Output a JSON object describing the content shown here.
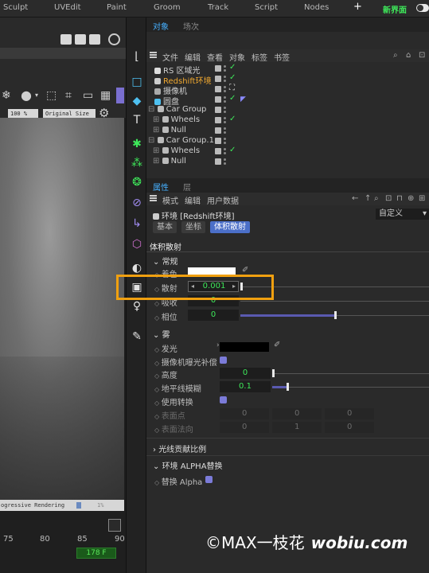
{
  "topbar": {
    "menus": [
      "Sculpt",
      "UVEdit",
      "Paint",
      "Groom",
      "Track",
      "Script",
      "Nodes"
    ],
    "plus": "+",
    "new_layout": "新界面"
  },
  "viewport": {
    "select_zoom": "100 %",
    "select_size": "Original Size",
    "progress_text": "ogressive Rendering",
    "progress_pct": "1%",
    "ticks": [
      "75",
      "80",
      "85",
      "90"
    ],
    "current_frame": "178 F"
  },
  "objects_panel": {
    "tab_objects": "对象",
    "tab_scene": "场次",
    "menu": [
      "文件",
      "编辑",
      "查看",
      "对象",
      "标签",
      "书签"
    ],
    "rows": [
      {
        "name": "RS 区域光",
        "indent": 0,
        "highlight": false
      },
      {
        "name": "Redshift环境",
        "indent": 0,
        "highlight": true
      },
      {
        "name": "摄像机",
        "indent": 0,
        "highlight": false
      },
      {
        "name": "圆盘",
        "indent": 0,
        "highlight": false
      },
      {
        "name": "Car Group",
        "indent": 0,
        "highlight": false
      },
      {
        "name": "Wheels",
        "indent": 1,
        "highlight": false
      },
      {
        "name": "Null",
        "indent": 1,
        "highlight": false
      },
      {
        "name": "Car Group.1",
        "indent": 0,
        "highlight": false
      },
      {
        "name": "Wheels",
        "indent": 1,
        "highlight": false
      },
      {
        "name": "Null",
        "indent": 1,
        "highlight": false
      }
    ]
  },
  "attributes_panel": {
    "tab_attributes": "属性",
    "tab_layers": "层",
    "menu": [
      "模式",
      "编辑",
      "用户数据"
    ],
    "object_title": "环境 [Redshift环境]",
    "preset": "自定义",
    "subtabs": [
      "基本",
      "坐标",
      "体积散射"
    ],
    "section_title": "体积散射",
    "group_general": "常规",
    "props_general": [
      {
        "label": "着色",
        "value": ""
      },
      {
        "label": "散射",
        "value": "0.001"
      },
      {
        "label": "吸收",
        "value": "0"
      },
      {
        "label": "相位",
        "value": "0"
      }
    ],
    "group_fog": "雾",
    "props_fog": [
      {
        "label": "发光",
        "value": ""
      },
      {
        "label": "摄像机曝光补偿",
        "value": ""
      },
      {
        "label": "高度",
        "value": "0"
      },
      {
        "label": "地平线模糊",
        "value": "0.1"
      },
      {
        "label": "使用转换",
        "value": ""
      },
      {
        "label": "表面点",
        "value": ""
      },
      {
        "label": "表面法向",
        "value": ""
      }
    ],
    "surface_point": [
      "0",
      "0",
      "0"
    ],
    "surface_normal": [
      "0",
      "1",
      "0"
    ],
    "group_ray": "光线贡献比例",
    "group_alpha": "环境 ALPHA替换",
    "alpha_label": "替换 Alpha"
  },
  "watermark": {
    "left": "©MAX一枝花",
    "right": "wobiu.com"
  },
  "colors": {
    "accent_green": "#3ee85a",
    "accent_blue": "#46b0ff",
    "highlight_orange": "#f0a010",
    "active_tab": "#4b6fc8"
  }
}
